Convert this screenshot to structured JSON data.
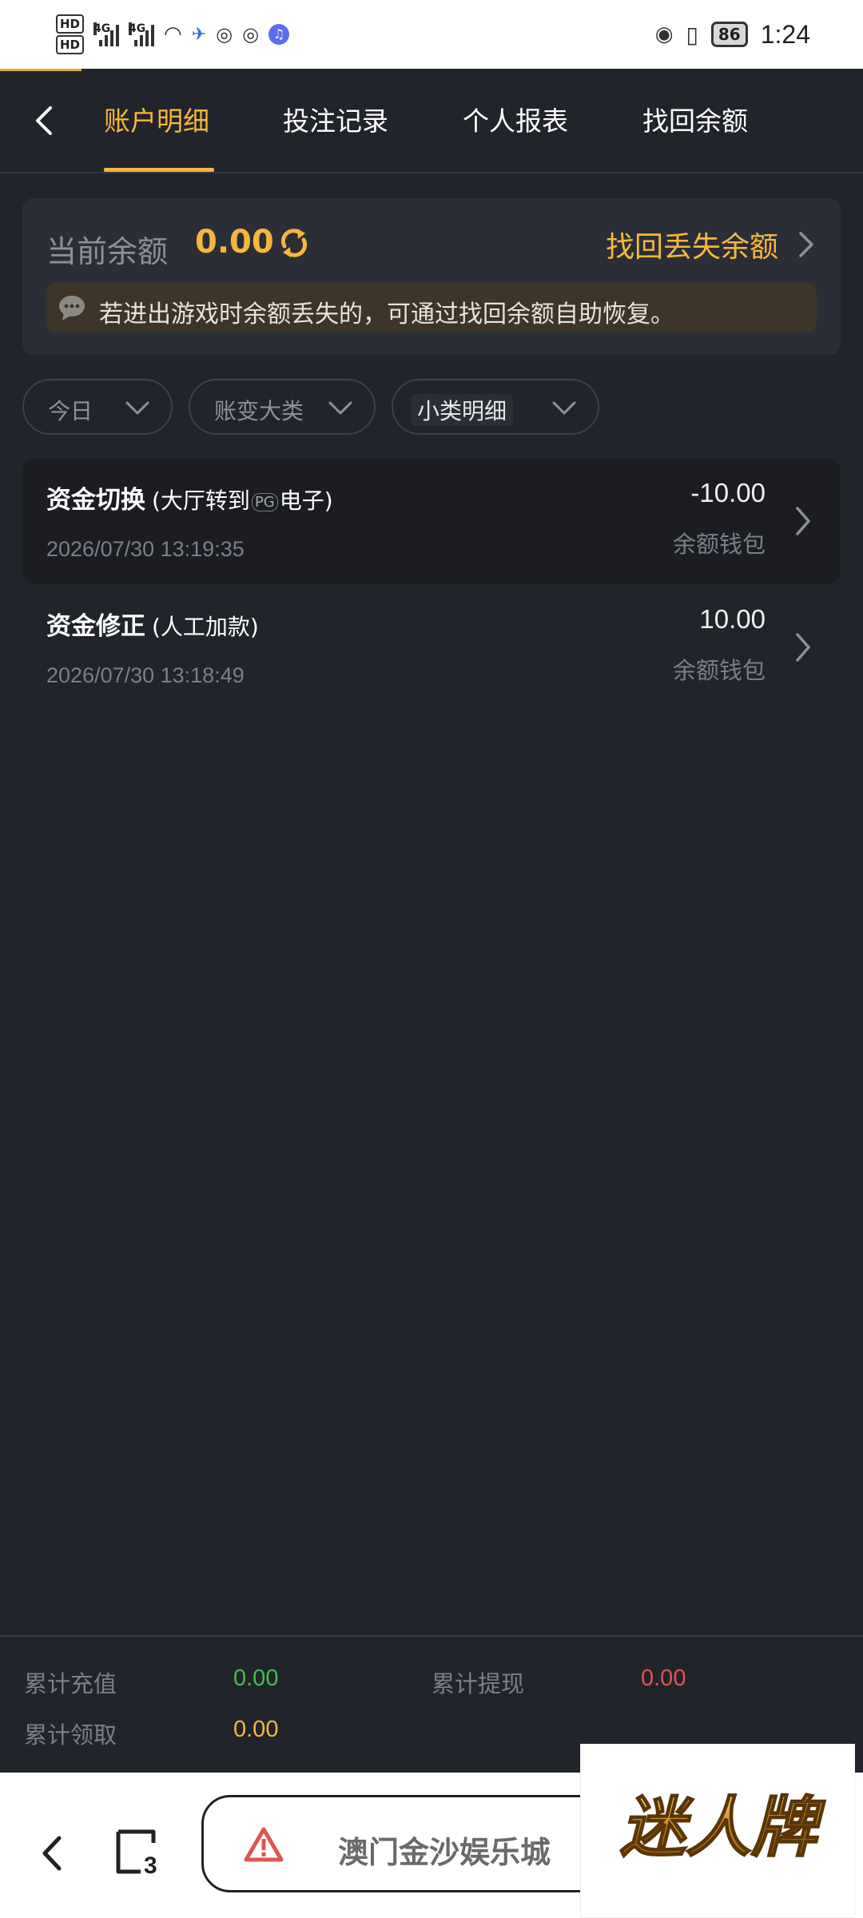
{
  "status_bar": {
    "hd1": "HD",
    "hd2": "HD",
    "net1": "4G",
    "net2": "4G",
    "battery": "86",
    "time": "1:24"
  },
  "nav": {
    "tabs": [
      "账户明细",
      "投注记录",
      "个人报表",
      "找回余额"
    ],
    "active_tab": "账户明细"
  },
  "balance": {
    "label": "当前余额",
    "value": "0.00",
    "recover_link": "找回丢失余额",
    "notice": "若进出游戏时余额丢失的，可通过找回余额自助恢复。"
  },
  "filters": [
    {
      "label": "今日"
    },
    {
      "label": "账变大类"
    },
    {
      "label": "小类明细"
    }
  ],
  "records": [
    {
      "title": "资金切换",
      "detail_prefix": "(大厅转到",
      "detail_logo": "PG",
      "detail_suffix": "电子)",
      "time": "2026/07/30 13:19:35",
      "amount": "-10.00",
      "wallet": "余额钱包"
    },
    {
      "title": "资金修正",
      "detail_prefix": "(人工加款)",
      "time": "2026/07/30 13:18:49",
      "amount": "10.00",
      "wallet": "余额钱包"
    }
  ],
  "summary": {
    "recharge_label": "累计充值",
    "recharge_value": "0.00",
    "withdraw_label": "累计提现",
    "withdraw_value": "0.00",
    "claim_label": "累计领取",
    "claim_value": "0.00"
  },
  "browser": {
    "tab_count": "3",
    "address_text": "澳门金沙娱乐城"
  },
  "watermark": {
    "text": "迷人牌"
  },
  "colors": {
    "accent": "#f5b73b",
    "background": "#22242c",
    "positive": "#3fbf4a",
    "negative": "#e05550"
  }
}
